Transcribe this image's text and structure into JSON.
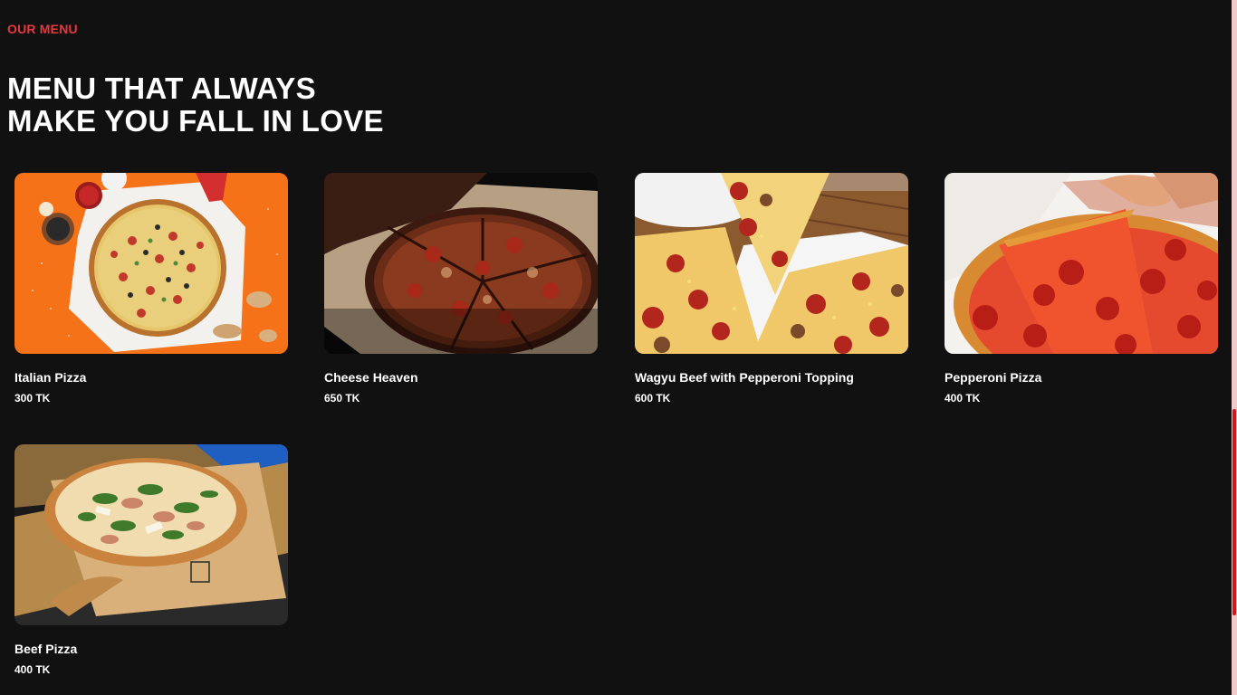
{
  "section": {
    "eyebrow": "OUR MENU",
    "headline_lines": [
      "MENU THAT ALWAYS",
      "MAKE YOU FALL IN LOVE"
    ]
  },
  "menu_items": [
    {
      "name": "Italian Pizza",
      "price": "300 TK"
    },
    {
      "name": "Cheese Heaven",
      "price": "650 TK"
    },
    {
      "name": "Wagyu Beef with Pepperoni Topping",
      "price": "600 TK"
    },
    {
      "name": "Pepperoni Pizza",
      "price": "400 TK"
    },
    {
      "name": "Beef Pizza",
      "price": "400 TK"
    }
  ],
  "colors": {
    "background": "#111111",
    "accent": "#e8383d",
    "text": "#ffffff",
    "scrollbar_thumb": "#d4161d"
  }
}
